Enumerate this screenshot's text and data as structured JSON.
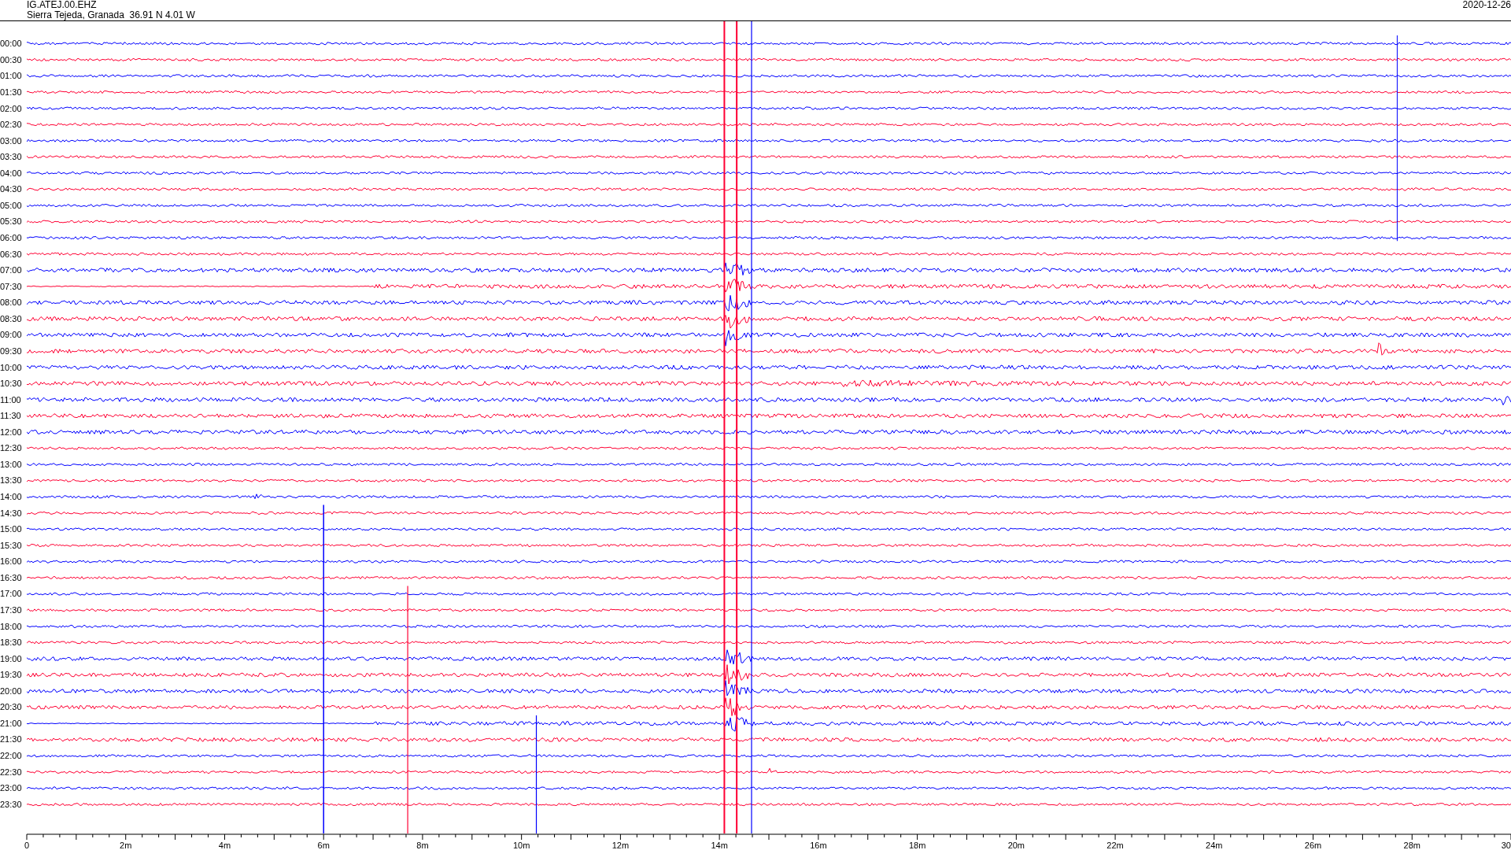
{
  "header": {
    "station": "IG.ATEJ.00.EHZ",
    "location": "Sierra Tejeda, Granada  36.91 N 4.01 W",
    "date": "2020-12-26"
  },
  "rows": [
    {
      "label": "00:00",
      "color": "#0000ff"
    },
    {
      "label": "00:30",
      "color": "#ff0033"
    },
    {
      "label": "01:00",
      "color": "#0000ff"
    },
    {
      "label": "01:30",
      "color": "#ff0033"
    },
    {
      "label": "02:00",
      "color": "#0000ff"
    },
    {
      "label": "02:30",
      "color": "#ff0033"
    },
    {
      "label": "03:00",
      "color": "#0000ff"
    },
    {
      "label": "03:30",
      "color": "#ff0033"
    },
    {
      "label": "04:00",
      "color": "#0000ff"
    },
    {
      "label": "04:30",
      "color": "#ff0033"
    },
    {
      "label": "05:00",
      "color": "#0000ff"
    },
    {
      "label": "05:30",
      "color": "#ff0033"
    },
    {
      "label": "06:00",
      "color": "#0000ff"
    },
    {
      "label": "06:30",
      "color": "#ff0033"
    },
    {
      "label": "07:00",
      "color": "#0000ff"
    },
    {
      "label": "07:30",
      "color": "#ff0033"
    },
    {
      "label": "08:00",
      "color": "#0000ff"
    },
    {
      "label": "08:30",
      "color": "#ff0033"
    },
    {
      "label": "09:00",
      "color": "#0000ff"
    },
    {
      "label": "09:30",
      "color": "#ff0033"
    },
    {
      "label": "10:00",
      "color": "#0000ff"
    },
    {
      "label": "10:30",
      "color": "#ff0033"
    },
    {
      "label": "11:00",
      "color": "#0000ff"
    },
    {
      "label": "11:30",
      "color": "#ff0033"
    },
    {
      "label": "12:00",
      "color": "#0000ff"
    },
    {
      "label": "12:30",
      "color": "#ff0033"
    },
    {
      "label": "13:00",
      "color": "#0000ff"
    },
    {
      "label": "13:30",
      "color": "#ff0033"
    },
    {
      "label": "14:00",
      "color": "#0000ff"
    },
    {
      "label": "14:30",
      "color": "#ff0033"
    },
    {
      "label": "15:00",
      "color": "#0000ff"
    },
    {
      "label": "15:30",
      "color": "#ff0033"
    },
    {
      "label": "16:00",
      "color": "#0000ff"
    },
    {
      "label": "16:30",
      "color": "#ff0033"
    },
    {
      "label": "17:00",
      "color": "#0000ff"
    },
    {
      "label": "17:30",
      "color": "#ff0033"
    },
    {
      "label": "18:00",
      "color": "#0000ff"
    },
    {
      "label": "18:30",
      "color": "#ff0033"
    },
    {
      "label": "19:00",
      "color": "#0000ff"
    },
    {
      "label": "19:30",
      "color": "#ff0033"
    },
    {
      "label": "20:00",
      "color": "#0000ff"
    },
    {
      "label": "20:30",
      "color": "#ff0033"
    },
    {
      "label": "21:00",
      "color": "#0000ff"
    },
    {
      "label": "21:30",
      "color": "#ff0033"
    },
    {
      "label": "22:00",
      "color": "#0000ff"
    },
    {
      "label": "22:30",
      "color": "#ff0033"
    },
    {
      "label": "23:00",
      "color": "#0000ff"
    },
    {
      "label": "23:30",
      "color": "#ff0033"
    }
  ],
  "x_axis": {
    "ticks": [
      "0",
      "2m",
      "4m",
      "6m",
      "8m",
      "10m",
      "12m",
      "14m",
      "16m",
      "18m",
      "20m",
      "22m",
      "24m",
      "26m",
      "28m",
      "30"
    ]
  }
}
